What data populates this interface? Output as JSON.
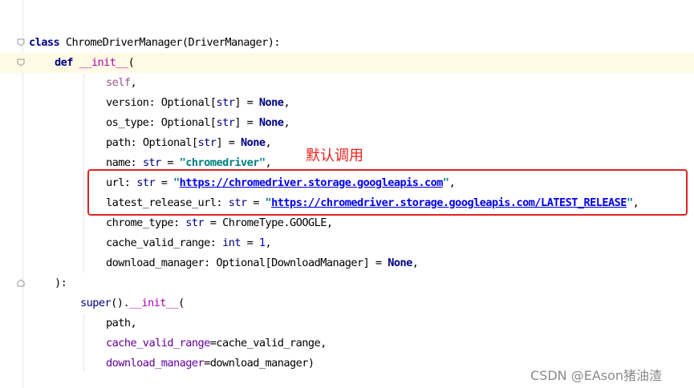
{
  "code": {
    "class_kw": "class",
    "class_name": "ChromeDriverManager",
    "class_base": "(DriverManager):",
    "def_kw": "def",
    "init_name": "__init__",
    "open_paren": "(",
    "self_kw": "self",
    "comma": ",",
    "version_param": "version",
    "os_type_param": "os_type",
    "path_param": "path",
    "name_param": "name",
    "url_param": "url",
    "latest_release_url_param": "latest_release_url",
    "chrome_type_param": "chrome_type",
    "cache_valid_range_param": "cache_valid_range",
    "download_manager_param": "download_manager",
    "colon_optional": ": Optional[",
    "colon_space": ": ",
    "str_type": "str",
    "int_type": "int",
    "close_bracket_eq": "] = ",
    "eq": " = ",
    "none_kw": "None",
    "name_value": "\"chromedriver\"",
    "quote": "\"",
    "url_value": "https://chromedriver.storage.googleapis.com",
    "latest_release_url_value": "https://chromedriver.storage.googleapis.com/LATEST_RELEASE",
    "chrome_type_value": "ChromeType.GOOGLE",
    "cache_value": "1",
    "dm_type_prefix": ": Optional[",
    "dm_type": "DownloadManager",
    "close_paren_colon": "):",
    "super_kw": "super",
    "super_call": "().",
    "path_arg": "path,",
    "cache_kwarg": "cache_valid_range",
    "cache_kwarg_value": "=cache_valid_range,",
    "download_kwarg": "download_manager",
    "download_kwarg_value": "=download_manager)"
  },
  "annotation": "默认调用",
  "watermark": "CSDN @EAson猪油渣",
  "colors": {
    "highlight_box": "#e02424",
    "annotation": "#e8201b",
    "current_line": "#fffae3"
  }
}
